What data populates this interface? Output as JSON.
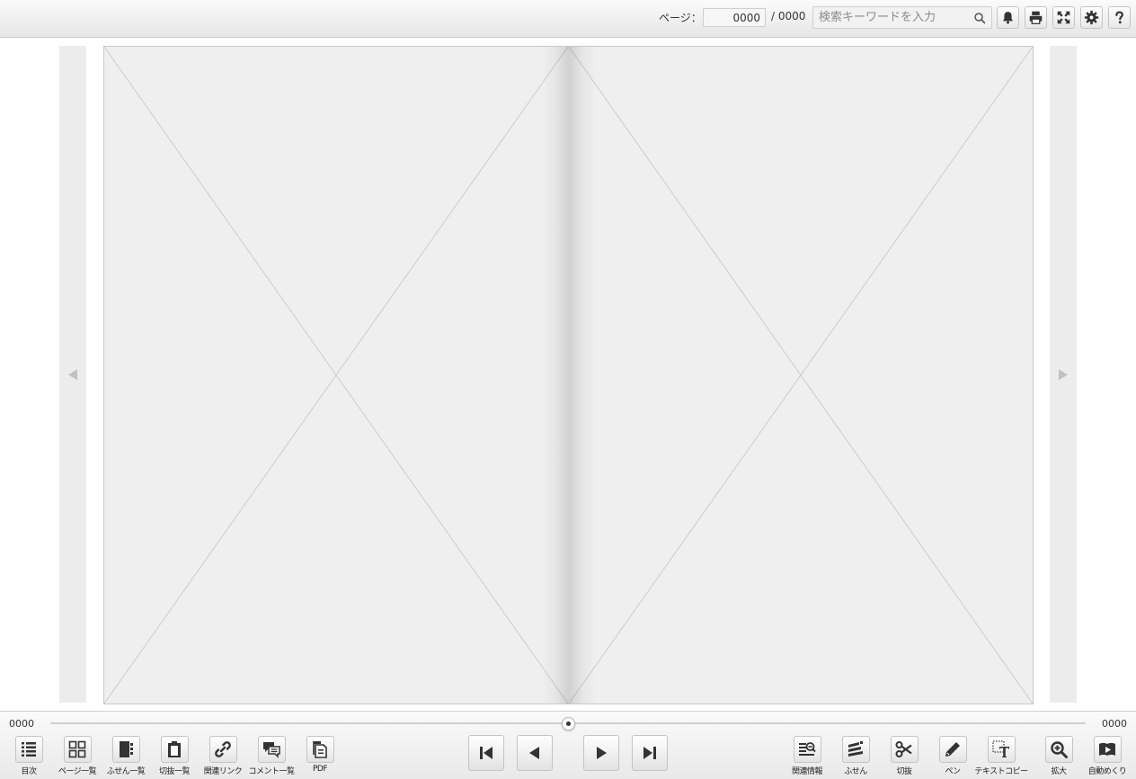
{
  "header": {
    "page_label": "ページ：",
    "current_page": "0000",
    "total_pages": "/ 0000",
    "search_placeholder": "検索キーワードを入力",
    "icons": [
      "search-icon",
      "bell-icon",
      "print-icon",
      "fullscreen-icon",
      "gear-icon",
      "help-icon"
    ]
  },
  "viewer": {
    "prev_arrow": "left-triangle",
    "next_arrow": "right-triangle",
    "left_page": "image-placeholder",
    "right_page": "image-placeholder"
  },
  "slider": {
    "start": "0000",
    "end": "0000",
    "position": 0.5
  },
  "toolbar_left": [
    {
      "label": "目次",
      "icon": "list-icon"
    },
    {
      "label": "ページ一覧",
      "icon": "grid-icon"
    },
    {
      "label": "ふせん一覧",
      "icon": "sticky-notes-icon"
    },
    {
      "label": "切抜一覧",
      "icon": "clipboard-icon"
    },
    {
      "label": "関連リンク",
      "icon": "link-icon"
    },
    {
      "label": "コメント一覧",
      "icon": "comments-icon"
    },
    {
      "label": "PDF",
      "icon": "pdf-icon"
    }
  ],
  "toolbar_center": [
    "first-page-icon",
    "prev-page-icon",
    "next-page-icon",
    "last-page-icon"
  ],
  "toolbar_right": [
    {
      "label": "関連情報",
      "icon": "related-info-icon"
    },
    {
      "label": "ふせん",
      "icon": "sticky-note-icon"
    },
    {
      "label": "切抜",
      "icon": "scissors-icon"
    },
    {
      "label": "ペン",
      "icon": "pen-icon"
    },
    {
      "label": "テキストコピー",
      "icon": "text-copy-icon"
    },
    {
      "label": "拡大",
      "icon": "zoom-in-icon"
    },
    {
      "label": "自動めくり",
      "icon": "autoplay-icon"
    }
  ],
  "colors": {
    "icon": "#333333",
    "page_bg": "#efefef",
    "side_nav_bg": "#ececec",
    "arrow": "#c0c0c0"
  }
}
